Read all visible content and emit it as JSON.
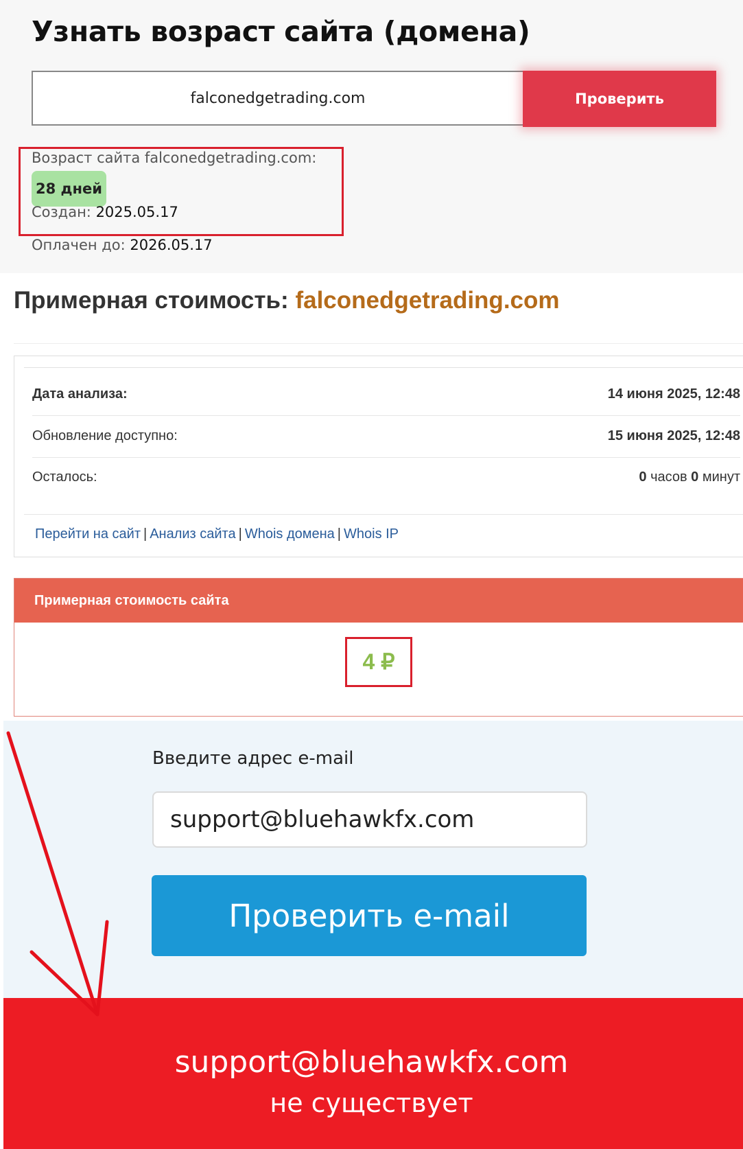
{
  "age_check": {
    "title": "Узнать возраст сайта (домена)",
    "domain_input_value": "falconedgetrading.com",
    "check_button_label": "Проверить",
    "age_label": "Возраст сайта falconedgetrading.com:",
    "age_badge": "28 дней",
    "created_label": "Создан:",
    "created_value": "2025.05.17",
    "paid_until_label": "Оплачен до:",
    "paid_until_value": "2026.05.17"
  },
  "cost": {
    "title_prefix": "Примерная стоимость:",
    "title_domain": "falconedgetrading.com",
    "rows": [
      {
        "label": "Дата анализа:",
        "value": "14 июня 2025, 12:48"
      },
      {
        "label": "Обновление доступно:",
        "value": "15 июня 2025, 12:48"
      },
      {
        "label": "Осталось:",
        "value_hours_num": "0",
        "value_hours_unit": "часов",
        "value_min_num": "0",
        "value_min_unit": "минут"
      }
    ],
    "links": [
      "Перейти на сайт",
      "Анализ сайта",
      "Whois домена",
      "Whois IP"
    ],
    "link_separator": "|",
    "estimate_header": "Примерная стоимость сайта",
    "estimate_value": "4 ₽"
  },
  "email_check": {
    "label": "Введите адрес e-mail",
    "input_value": "support@bluehawkfx.com",
    "button_label": "Проверить e-mail",
    "result_email": "support@bluehawkfx.com",
    "result_status": "не существует"
  },
  "colors": {
    "accent_red": "#e0394a",
    "badge_green": "#a9e2a2",
    "domain_orange": "#b56b1a",
    "estimate_header": "#e66350",
    "price_green": "#8cbc4d",
    "email_button_blue": "#1b98d6",
    "result_red": "#ed1c24",
    "highlight_red": "#d9202d"
  }
}
